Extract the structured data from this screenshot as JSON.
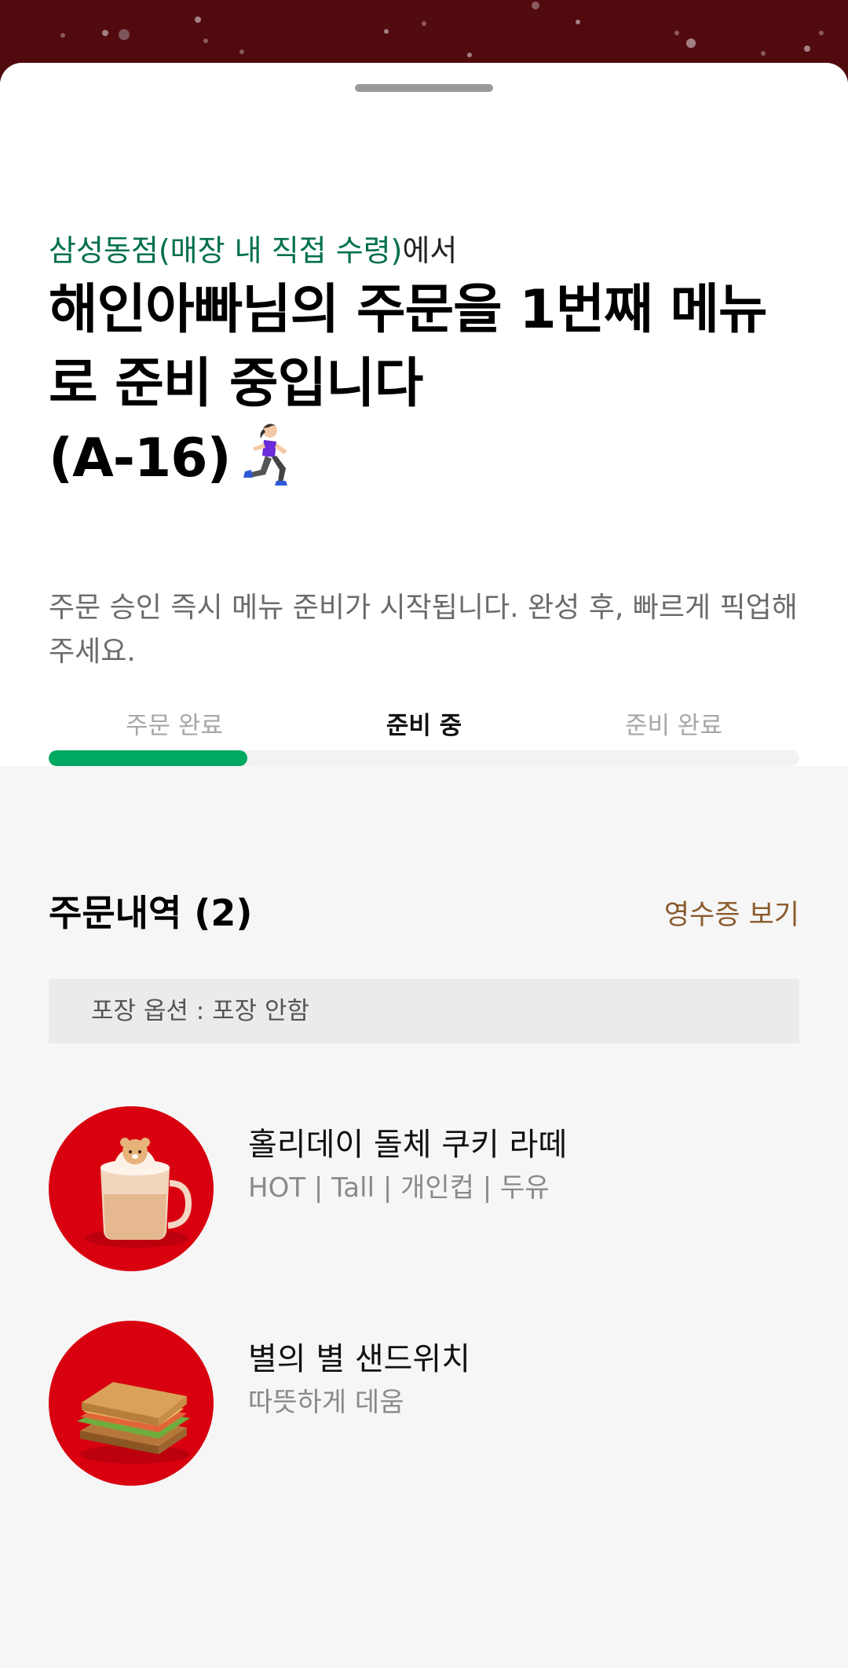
{
  "header": {
    "store_name": "삼성동점(매장 내 직접 수령)",
    "store_suffix": "에서",
    "headline_text": "해인아빠님의 주문을 1번째 메뉴로 준비 중입니다",
    "order_number": "(A-16)",
    "runner_icon": "woman-running-icon",
    "description": "주문 승인 즉시 메뉴 준비가 시작됩니다. 완성 후, 빠르게 픽업해 주세요."
  },
  "progress": {
    "steps": [
      "주문 완료",
      "준비 중",
      "준비 완료"
    ],
    "active_index": 1,
    "fill_fraction": 0.265
  },
  "order_history": {
    "title": "주문내역 (2)",
    "receipt_label": "영수증 보기",
    "packaging_option": "포장 옵션 : 포장 안함",
    "items": [
      {
        "name": "홀리데이 돌체 쿠키 라떼",
        "options": "HOT | Tall | 개인컵 | 두유",
        "icon": "latte-icon"
      },
      {
        "name": "별의 별 샌드위치",
        "options": "따뜻하게 데움",
        "icon": "sandwich-icon"
      }
    ]
  },
  "colors": {
    "brand_green": "#00704a",
    "progress_green": "#00a862",
    "receipt_brown": "#8a5a2c",
    "header_maroon": "#510a0e",
    "thumb_red": "#d9000f"
  }
}
